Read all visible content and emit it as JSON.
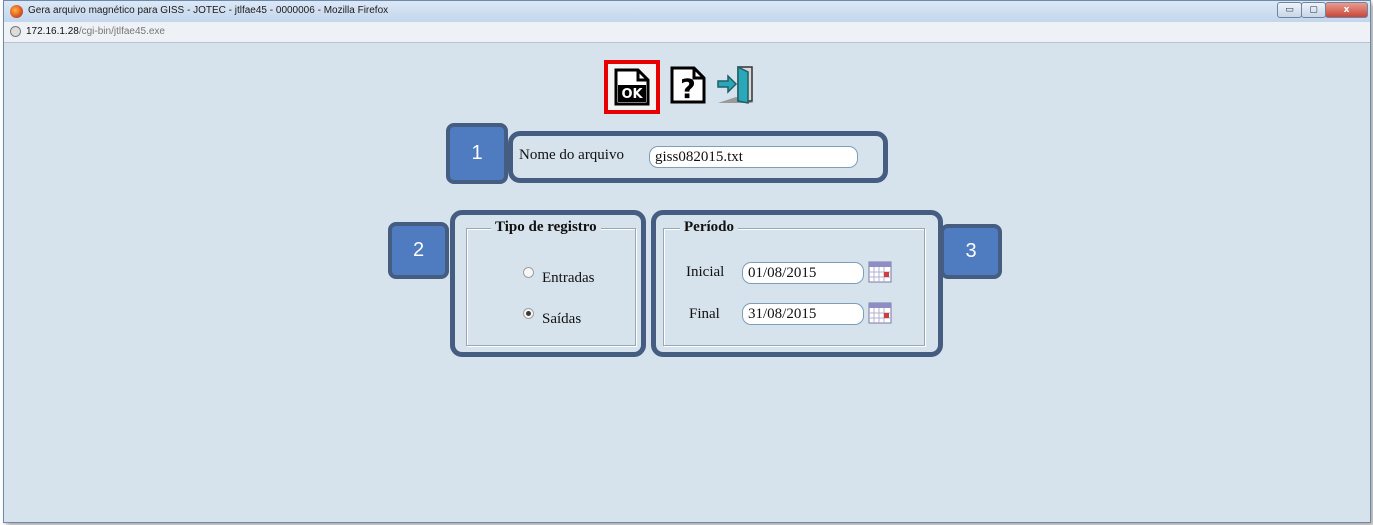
{
  "window": {
    "title": "Gera arquivo magnético para GISS - JOTEC - jtlfae45 - 0000006 - Mozilla Firefox",
    "controls": {
      "minimize": "▭",
      "maximize": "▢",
      "close": "x"
    }
  },
  "address_bar": {
    "host": "172.16.1.28",
    "path": "/cgi-bin/jtlfae45.exe"
  },
  "toolbar": {
    "ok_label": "OK",
    "help_label": "?",
    "icons": [
      "ok-document-icon",
      "help-icon",
      "exit-door-icon"
    ],
    "highlight_color": "#e60000"
  },
  "form": {
    "filename": {
      "label": "Nome do arquivo",
      "value": "giss082015.txt"
    },
    "tipo_registro": {
      "legend": "Tipo de registro",
      "options": [
        {
          "label": "Entradas",
          "selected": false
        },
        {
          "label": "Saídas",
          "selected": true
        }
      ]
    },
    "periodo": {
      "legend": "Período",
      "inicial": {
        "label": "Inicial",
        "value": "01/08/2015"
      },
      "final": {
        "label": "Final",
        "value": "31/08/2015"
      }
    }
  },
  "callouts": [
    "1",
    "2",
    "3"
  ],
  "colors": {
    "background": "#d6e2ec",
    "callout_border": "#455d81",
    "callout_fill": "#4f7cc0"
  }
}
